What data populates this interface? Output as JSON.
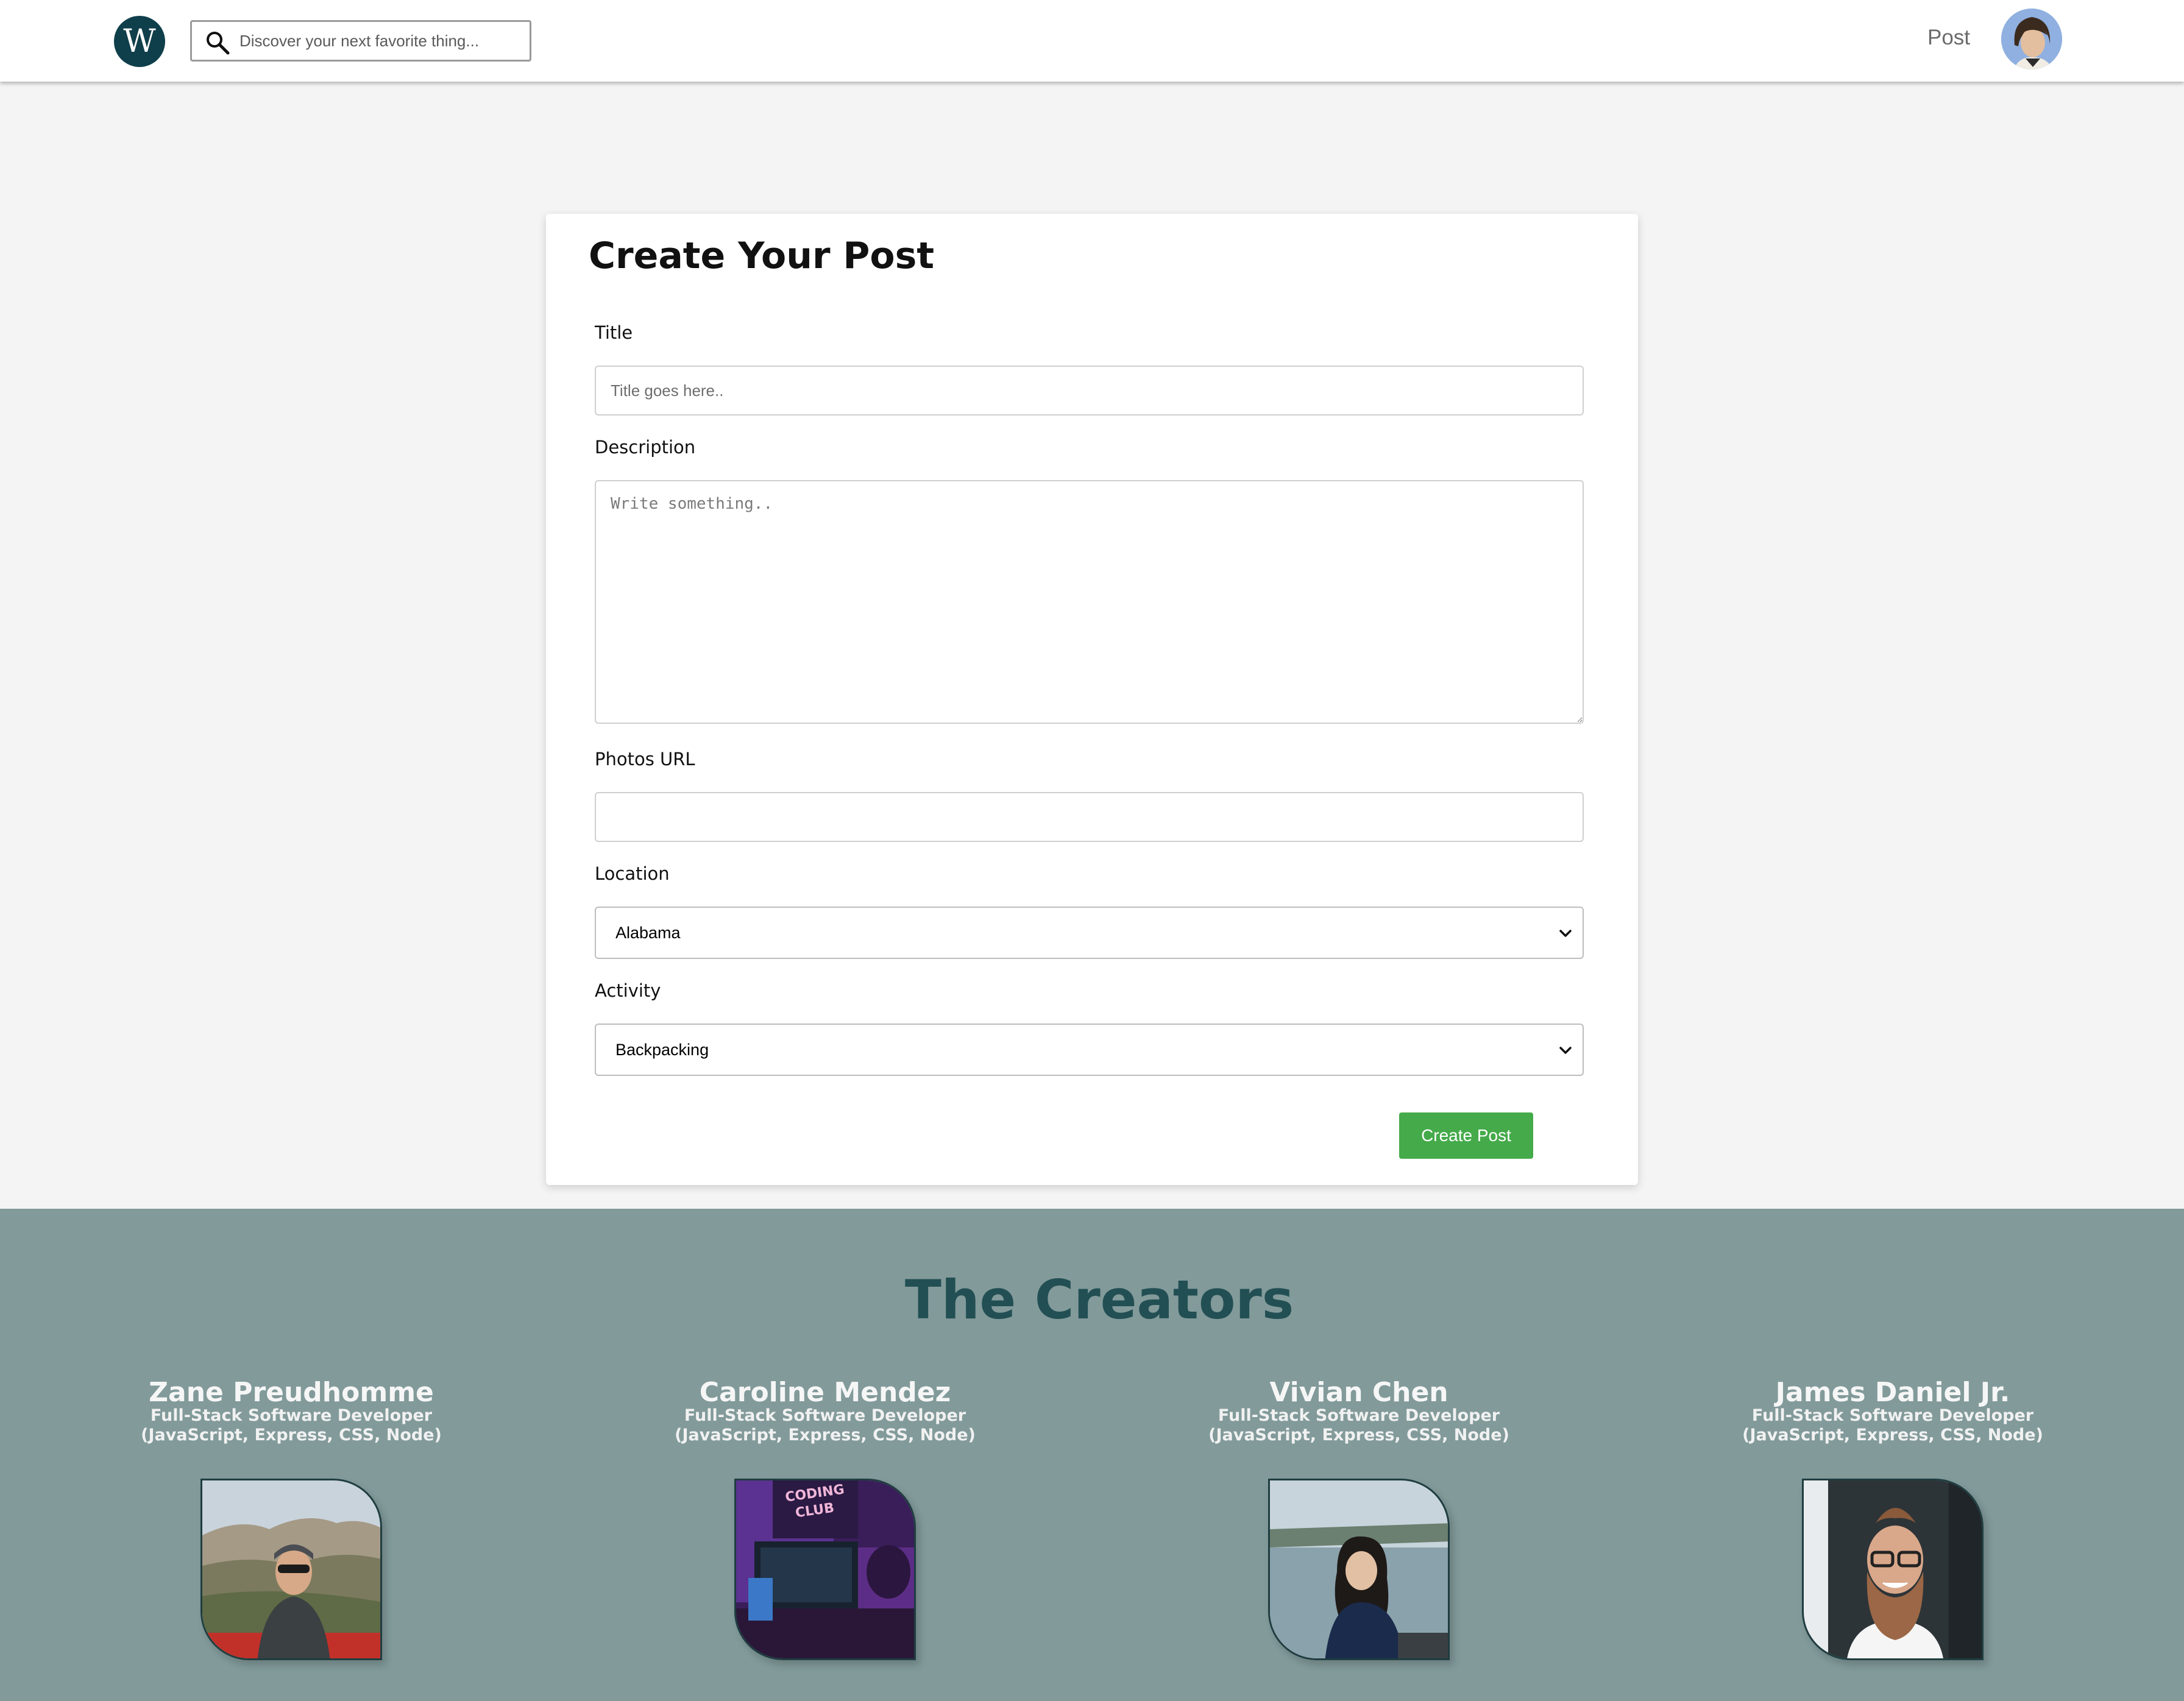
{
  "header": {
    "logo_letter": "W",
    "search_placeholder": "Discover your next favorite thing...",
    "nav_post_label": "Post"
  },
  "form": {
    "heading": "Create Your Post",
    "title_label": "Title",
    "title_placeholder": "Title goes here..",
    "description_label": "Description",
    "description_placeholder": "Write something..",
    "photos_label": "Photos URL",
    "photos_value": "",
    "location_label": "Location",
    "location_selected": "Alabama",
    "activity_label": "Activity",
    "activity_selected": "Backpacking",
    "submit_label": "Create Post"
  },
  "creators": {
    "heading": "The Creators",
    "people": [
      {
        "name": "Zane Preudhomme",
        "role": "Full-Stack Software Developer",
        "stack": "(JavaScript, Express, CSS, Node)"
      },
      {
        "name": "Caroline Mendez",
        "role": "Full-Stack Software Developer",
        "stack": "(JavaScript, Express, CSS, Node)",
        "photo_sign": "CODING CLUB"
      },
      {
        "name": "Vivian Chen",
        "role": "Full-Stack Software Developer",
        "stack": "(JavaScript, Express, CSS, Node)"
      },
      {
        "name": "James Daniel Jr.",
        "role": "Full-Stack Software Developer",
        "stack": "(JavaScript, Express, CSS, Node)"
      }
    ]
  },
  "colors": {
    "logo_bg": "#0f3f4a",
    "submit_bg": "#45aa4a",
    "creators_bg": "#829a9a",
    "creators_heading": "#224f54"
  },
  "icons": [
    "search-icon",
    "chevron-down-icon"
  ]
}
